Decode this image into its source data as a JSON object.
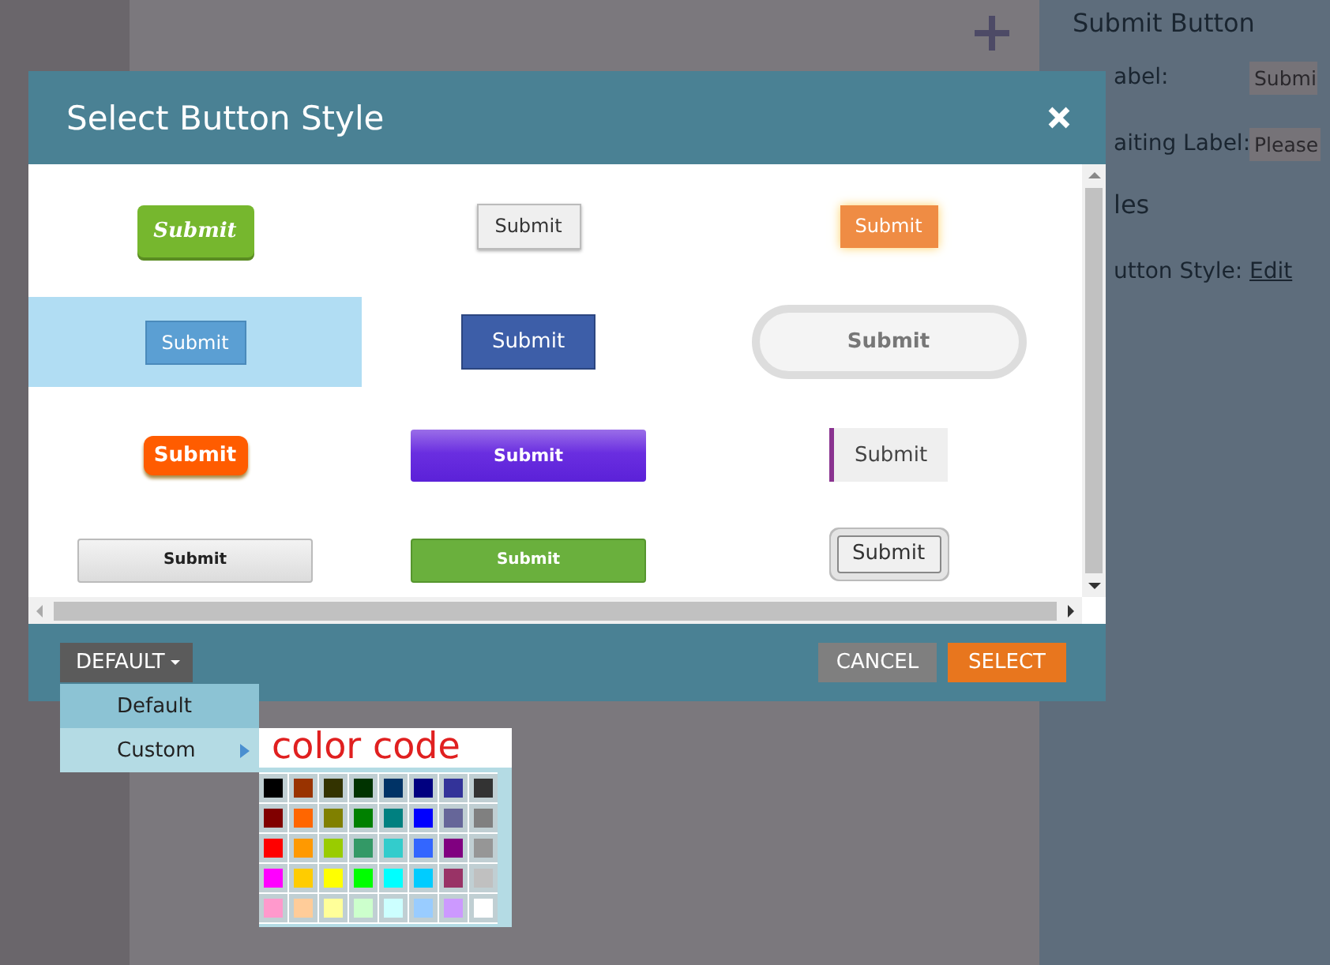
{
  "background_page": {
    "panel_title": "Submit Button",
    "fields": [
      {
        "label": "abel:",
        "value": "Submi"
      },
      {
        "label": "aiting Label:",
        "value": "Please"
      }
    ],
    "section": "les",
    "style_row": {
      "label": "utton Style:",
      "link": "Edit"
    }
  },
  "dialog": {
    "title": "Select Button Style",
    "styles": [
      {
        "label": "Submit",
        "kind": "green-italic",
        "selected": false
      },
      {
        "label": "Submit",
        "kind": "plain-grey",
        "selected": false
      },
      {
        "label": "Submit",
        "kind": "orange-glow",
        "selected": false
      },
      {
        "label": "Submit",
        "kind": "light-blue",
        "selected": true
      },
      {
        "label": "Submit",
        "kind": "dark-blue",
        "selected": false
      },
      {
        "label": "Submit",
        "kind": "pill",
        "selected": false
      },
      {
        "label": "Submit",
        "kind": "orange-bold",
        "selected": false
      },
      {
        "label": "Submit",
        "kind": "purple-wide",
        "selected": false
      },
      {
        "label": "Submit",
        "kind": "left-bar",
        "selected": false
      },
      {
        "label": "Submit",
        "kind": "grey-wide",
        "selected": false
      },
      {
        "label": "Submit",
        "kind": "green-wide",
        "selected": false
      },
      {
        "label": "Submit",
        "kind": "framed",
        "selected": false
      }
    ],
    "dropdown": {
      "label": "DEFAULT",
      "items": [
        {
          "label": "Default",
          "selected": false,
          "submenu": false
        },
        {
          "label": "Custom",
          "selected": true,
          "submenu": true
        }
      ]
    },
    "buttons": [
      {
        "label": "CANCEL",
        "kind": "secondary"
      },
      {
        "label": "SELECT",
        "kind": "primary"
      }
    ]
  },
  "color_picker": {
    "title": "color code",
    "swatches": [
      {
        "color": "#000000"
      },
      {
        "color": "#993300"
      },
      {
        "color": "#333300"
      },
      {
        "color": "#003300"
      },
      {
        "color": "#003366"
      },
      {
        "color": "#000080"
      },
      {
        "color": "#333399"
      },
      {
        "color": "#333333"
      },
      {
        "color": "#800000"
      },
      {
        "color": "#ff6600"
      },
      {
        "color": "#808000"
      },
      {
        "color": "#008000"
      },
      {
        "color": "#008080"
      },
      {
        "color": "#0000ff"
      },
      {
        "color": "#666699"
      },
      {
        "color": "#808080"
      },
      {
        "color": "#ff0000"
      },
      {
        "color": "#ff9900"
      },
      {
        "color": "#99cc00"
      },
      {
        "color": "#339966"
      },
      {
        "color": "#33cccc"
      },
      {
        "color": "#3366ff"
      },
      {
        "color": "#800080"
      },
      {
        "color": "#969696"
      },
      {
        "color": "#ff00ff"
      },
      {
        "color": "#ffcc00"
      },
      {
        "color": "#ffff00"
      },
      {
        "color": "#00ff00"
      },
      {
        "color": "#00ffff"
      },
      {
        "color": "#00ccff"
      },
      {
        "color": "#993366"
      },
      {
        "color": "#c0c0c0"
      },
      {
        "color": "#ff99cc"
      },
      {
        "color": "#ffcc99"
      },
      {
        "color": "#ffff99"
      },
      {
        "color": "#ccffcc"
      },
      {
        "color": "#ccffff"
      },
      {
        "color": "#99ccff"
      },
      {
        "color": "#cc99ff"
      },
      {
        "color": "#ffffff"
      }
    ]
  }
}
